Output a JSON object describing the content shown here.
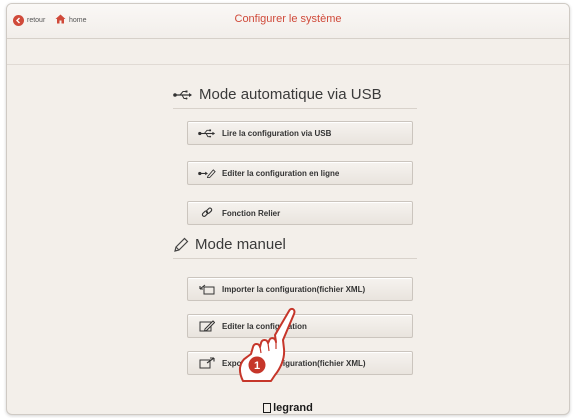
{
  "topbar": {
    "back_label": "retour",
    "home_label": "home",
    "title": "Configurer le système"
  },
  "sections": {
    "usb_title": "Mode automatique via USB",
    "manual_title": "Mode manuel"
  },
  "usb_options": [
    {
      "label": "Lire la configuration via USB",
      "icon": "usb-icon"
    },
    {
      "label": "Editer la configuration en ligne",
      "icon": "usb-edit-icon"
    },
    {
      "label": "Fonction Relier",
      "icon": "link-icon"
    }
  ],
  "manual_options": [
    {
      "label": "Importer la configuration(fichier XML)",
      "icon": "import-icon"
    },
    {
      "label": "Editer la configuration",
      "icon": "edit-icon"
    },
    {
      "label": "Exporter la configuration(fichier XML)",
      "icon": "export-icon"
    }
  ],
  "callout": {
    "number": "1"
  },
  "brand": {
    "name": "legrand"
  },
  "colors": {
    "accent": "#d04a3a",
    "background": "#f3efea"
  }
}
